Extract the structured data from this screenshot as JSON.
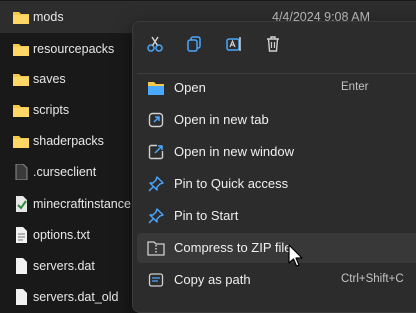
{
  "files": [
    {
      "name": "mods",
      "date": "4/4/2024 9:08 AM",
      "icon": "folder-icon",
      "selected": true
    },
    {
      "name": "resourcepacks",
      "icon": "folder-icon"
    },
    {
      "name": "saves",
      "icon": "folder-icon"
    },
    {
      "name": "scripts",
      "icon": "folder-icon"
    },
    {
      "name": "shaderpacks",
      "icon": "folder-icon"
    },
    {
      "name": ".curseclient",
      "icon": "file-icon"
    },
    {
      "name": "minecraftinstance.json",
      "icon": "json-file-icon"
    },
    {
      "name": "options.txt",
      "icon": "text-file-icon"
    },
    {
      "name": "servers.dat",
      "icon": "file-icon"
    },
    {
      "name": "servers.dat_old",
      "icon": "file-icon"
    }
  ],
  "context_menu": {
    "toolbar": [
      {
        "name": "cut",
        "icon": "scissors-icon"
      },
      {
        "name": "copy",
        "icon": "copy-icon"
      },
      {
        "name": "rename",
        "icon": "rename-icon"
      },
      {
        "name": "delete",
        "icon": "trash-icon"
      }
    ],
    "items": [
      {
        "label": "Open",
        "shortcut": "Enter",
        "icon": "folder-open-icon"
      },
      {
        "label": "Open in new tab",
        "shortcut": "",
        "icon": "new-tab-icon"
      },
      {
        "label": "Open in new window",
        "shortcut": "",
        "icon": "new-window-icon"
      },
      {
        "label": "Pin to Quick access",
        "shortcut": "",
        "icon": "pin-icon"
      },
      {
        "label": "Pin to Start",
        "shortcut": "",
        "icon": "pin-icon"
      },
      {
        "label": "Compress to ZIP file",
        "shortcut": "",
        "icon": "zip-folder-icon"
      },
      {
        "label": "Copy as path",
        "shortcut": "Ctrl+Shift+C",
        "icon": "copy-path-icon"
      }
    ]
  },
  "colors": {
    "accent": "#4aa8ff",
    "folder": "#f2c94c",
    "background": "#191919",
    "menu": "#2c2c2c"
  }
}
